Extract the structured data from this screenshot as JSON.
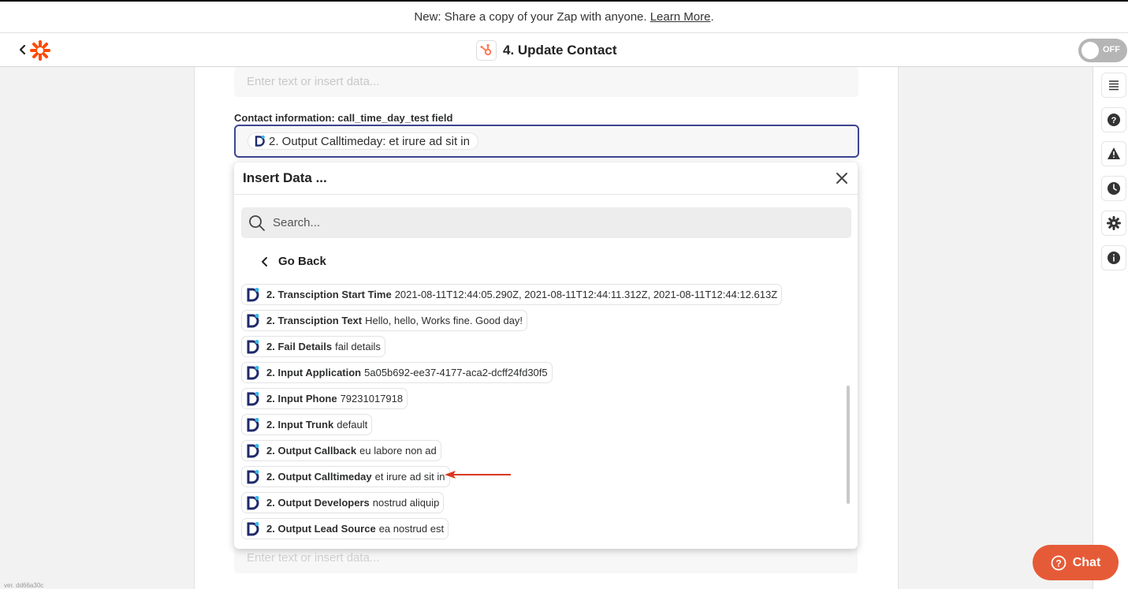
{
  "announcement": {
    "text": "New: Share a copy of your Zap with anyone. ",
    "link": "Learn More",
    "suffix": "."
  },
  "header": {
    "title": "4. Update Contact",
    "toggle_label": "OFF"
  },
  "form": {
    "placeholder_top": "Enter text or insert data...",
    "field_label": "Contact information: call_time_day_test field",
    "pill": {
      "name": "2. Output Calltimeday:",
      "value": "et irure ad sit in"
    },
    "placeholder_bottom": "Enter text or insert data..."
  },
  "dropdown": {
    "title": "Insert Data ...",
    "search_placeholder": "Search...",
    "go_back": "Go Back",
    "items": [
      {
        "name": "2. Transciption Start Time",
        "value": "2021-08-11T12:44:05.290Z, 2021-08-11T12:44:11.312Z, 2021-08-11T12:44:12.613Z"
      },
      {
        "name": "2. Transciption Text",
        "value": "Hello, hello, Works fine. Good day!"
      },
      {
        "name": "2. Fail Details",
        "value": "fail details"
      },
      {
        "name": "2. Input Application",
        "value": "5a05b692-ee37-4177-aca2-dcff24fd30f5"
      },
      {
        "name": "2. Input Phone",
        "value": "79231017918"
      },
      {
        "name": "2. Input Trunk",
        "value": "default"
      },
      {
        "name": "2. Output Callback",
        "value": "eu labore non ad"
      },
      {
        "name": "2. Output Calltimeday",
        "value": "et irure ad sit in"
      },
      {
        "name": "2. Output Developers",
        "value": "nostrud aliquip"
      },
      {
        "name": "2. Output Lead Source",
        "value": "ea nostrud est"
      }
    ]
  },
  "chat": {
    "label": "Chat"
  },
  "version": "ver. dd66a30c",
  "colors": {
    "accent": "#3d4592",
    "brand": "#ff4a00",
    "chat": "#e65b37",
    "arrow": "#d9391f"
  }
}
